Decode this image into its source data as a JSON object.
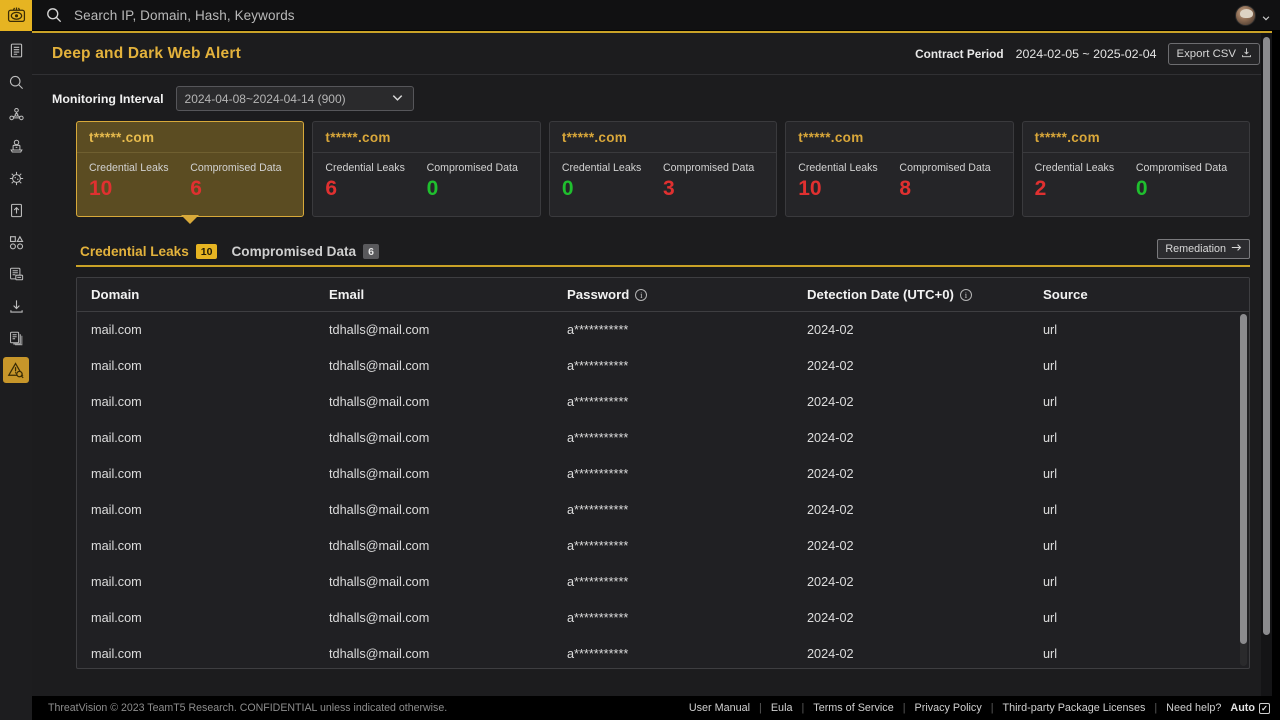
{
  "topbar": {
    "logo_icon": "threatvision-logo-icon",
    "search_icon": "search-icon",
    "search_placeholder": "Search IP, Domain, Hash, Keywords",
    "search_value": "",
    "avatar_icon": "user-avatar",
    "chevron_icon": "chevron-down-icon"
  },
  "sidebar": {
    "items": [
      {
        "name": "reports",
        "icon": "document-list-icon",
        "active": false
      },
      {
        "name": "search",
        "icon": "magnifier-icon",
        "active": false
      },
      {
        "name": "threat-graph",
        "icon": "network-graph-icon",
        "active": false
      },
      {
        "name": "adversary",
        "icon": "hacker-laptop-icon",
        "active": false
      },
      {
        "name": "malware",
        "icon": "virus-icon",
        "active": false
      },
      {
        "name": "sandbox-upload",
        "icon": "upload-file-icon",
        "active": false
      },
      {
        "name": "ioc-shapes",
        "icon": "shapes-icon",
        "active": false
      },
      {
        "name": "feeds",
        "icon": "article-comment-icon",
        "active": false
      },
      {
        "name": "downloads",
        "icon": "download-icon",
        "active": false
      },
      {
        "name": "collections",
        "icon": "stacked-docs-icon",
        "active": false
      },
      {
        "name": "alerts",
        "icon": "alert-triangle-search-icon",
        "active": true
      }
    ]
  },
  "page": {
    "title": "Deep and Dark Web Alert",
    "contract_label": "Contract Period",
    "contract_value": "2024-02-05 ~ 2025-02-04",
    "export_label": "Export CSV",
    "export_icon": "download-icon",
    "monitoring_label": "Monitoring Interval",
    "monitoring_value": "2024-04-08~2024-04-14 (900)",
    "monitoring_chevron": "chevron-down-icon"
  },
  "cards": [
    {
      "domain": "t*****.com",
      "metrics": [
        {
          "label": "Credential Leaks",
          "value": "10",
          "color": "red"
        },
        {
          "label": "Compromised Data",
          "value": "6",
          "color": "red"
        }
      ],
      "selected": true
    },
    {
      "domain": "t*****.com",
      "metrics": [
        {
          "label": "Credential Leaks",
          "value": "6",
          "color": "red"
        },
        {
          "label": "Compromised Data",
          "value": "0",
          "color": "green"
        }
      ],
      "selected": false
    },
    {
      "domain": "t*****.com",
      "metrics": [
        {
          "label": "Credential Leaks",
          "value": "0",
          "color": "green"
        },
        {
          "label": "Compromised Data",
          "value": "3",
          "color": "red"
        }
      ],
      "selected": false
    },
    {
      "domain": "t*****.com",
      "metrics": [
        {
          "label": "Credential Leaks",
          "value": "10",
          "color": "red"
        },
        {
          "label": "Compromised Data",
          "value": "8",
          "color": "red"
        }
      ],
      "selected": false
    },
    {
      "domain": "t*****.com",
      "metrics": [
        {
          "label": "Credential Leaks",
          "value": "2",
          "color": "red"
        },
        {
          "label": "Compromised Data",
          "value": "0",
          "color": "green"
        }
      ],
      "selected": false
    }
  ],
  "tabs": [
    {
      "label": "Credential Leaks",
      "count": "10",
      "active": true
    },
    {
      "label": "Compromised Data",
      "count": "6",
      "active": false
    }
  ],
  "remediation": {
    "label": "Remediation",
    "icon": "arrow-right-icon"
  },
  "table": {
    "columns": [
      {
        "label": "Domain",
        "info": false
      },
      {
        "label": "Email",
        "info": false
      },
      {
        "label": "Password",
        "info": true
      },
      {
        "label": "Detection Date (UTC+0)",
        "info": true
      },
      {
        "label": "Source",
        "info": false
      }
    ],
    "rows": [
      {
        "domain": "mail.com",
        "email": "tdhalls@mail.com",
        "password": "a***********",
        "date": "2024-02",
        "source": "url"
      },
      {
        "domain": "mail.com",
        "email": "tdhalls@mail.com",
        "password": "a***********",
        "date": "2024-02",
        "source": "url"
      },
      {
        "domain": "mail.com",
        "email": "tdhalls@mail.com",
        "password": "a***********",
        "date": "2024-02",
        "source": "url"
      },
      {
        "domain": "mail.com",
        "email": "tdhalls@mail.com",
        "password": "a***********",
        "date": "2024-02",
        "source": "url"
      },
      {
        "domain": "mail.com",
        "email": "tdhalls@mail.com",
        "password": "a***********",
        "date": "2024-02",
        "source": "url"
      },
      {
        "domain": "mail.com",
        "email": "tdhalls@mail.com",
        "password": "a***********",
        "date": "2024-02",
        "source": "url"
      },
      {
        "domain": "mail.com",
        "email": "tdhalls@mail.com",
        "password": "a***********",
        "date": "2024-02",
        "source": "url"
      },
      {
        "domain": "mail.com",
        "email": "tdhalls@mail.com",
        "password": "a***********",
        "date": "2024-02",
        "source": "url"
      },
      {
        "domain": "mail.com",
        "email": "tdhalls@mail.com",
        "password": "a***********",
        "date": "2024-02",
        "source": "url"
      },
      {
        "domain": "mail.com",
        "email": "tdhalls@mail.com",
        "password": "a***********",
        "date": "2024-02",
        "source": "url"
      }
    ]
  },
  "footer": {
    "copyright": "ThreatVision © 2023 TeamT5 Research. CONFIDENTIAL unless indicated otherwise.",
    "links": [
      "User Manual",
      "Eula",
      "Terms of Service",
      "Privacy Policy",
      "Third-party Package Licenses",
      "Need help?"
    ],
    "auto_label": "Auto",
    "auto_checked": true
  },
  "colors": {
    "accent": "#e3b23c",
    "danger": "#e03030",
    "ok": "#1fbf2e",
    "bg": "#1c1c1e"
  }
}
